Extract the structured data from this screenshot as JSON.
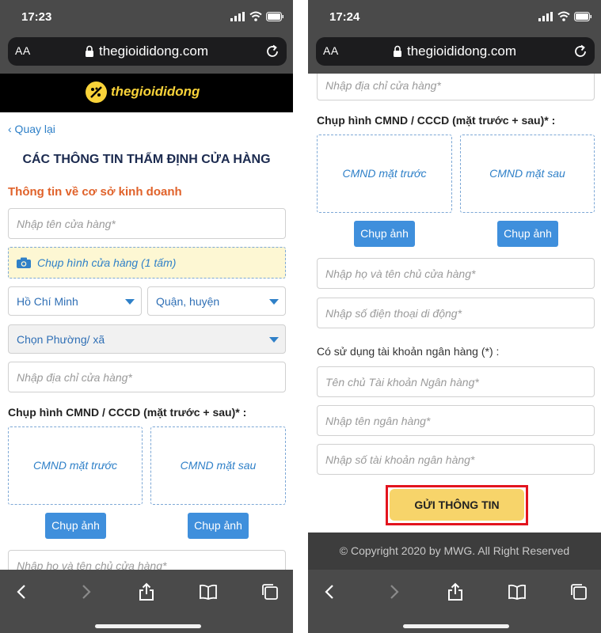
{
  "left": {
    "status": {
      "time": "17:23"
    },
    "url": {
      "aa_label": "AA",
      "host": "thegioididong.com"
    },
    "brand": {
      "name": "thegioididong"
    },
    "back_label": "‹ Quay lại",
    "title": "CÁC THÔNG TIN THẨM ĐỊNH CỬA HÀNG",
    "section_title": "Thông tin về cơ sở kinh doanh",
    "store_name_placeholder": "Nhập tên cửa hàng*",
    "store_photo_label": "Chụp hình cửa hàng (1 tấm)",
    "city_select": "Hồ Chí Minh",
    "district_select": "Quận, huyện",
    "ward_select": "Chọn Phường/ xã",
    "address_placeholder": "Nhập địa chỉ cửa hàng*",
    "id_section_label": "Chụp hình CMND / CCCD (mặt trước + sau)* :",
    "id_front_label": "CMND mặt trước",
    "id_back_label": "CMND mặt sau",
    "capture_label": "Chụp ảnh",
    "owner_name_placeholder": "Nhập họ và tên chủ cửa hàng*"
  },
  "right": {
    "status": {
      "time": "17:24"
    },
    "url": {
      "aa_label": "AA",
      "host": "thegioididong.com"
    },
    "address_placeholder": "Nhập địa chỉ cửa hàng*",
    "id_section_label": "Chụp hình CMND / CCCD (mặt trước + sau)* :",
    "id_front_label": "CMND mặt trước",
    "id_back_label": "CMND mặt sau",
    "capture_label": "Chụp ảnh",
    "owner_name_placeholder": "Nhập họ và tên chủ cửa hàng*",
    "phone_placeholder": "Nhập số điện thoại di động*",
    "bank_question": "Có sử dụng tài khoản ngân hàng (*) :",
    "bank_holder_placeholder": "Tên chủ Tài khoản Ngân hàng*",
    "bank_name_placeholder": "Nhập tên ngân hàng*",
    "bank_account_placeholder": "Nhập số tài khoản ngân hàng*",
    "submit_label": "GỬI THÔNG TIN",
    "footer_text": "© Copyright 2020 by MWG. All Right Reserved"
  },
  "colors": {
    "accent_blue": "#2f80c8",
    "section_orange": "#e0622a",
    "brand_yellow": "#f9d339",
    "submit_yellow": "#f7d46a",
    "highlight_red": "#e3141e"
  },
  "icons": [
    "signal-icon",
    "wifi-icon",
    "battery-icon",
    "lock-icon",
    "reload-icon",
    "camera-icon",
    "back-arrow-icon",
    "forward-arrow-icon",
    "share-icon",
    "bookmarks-icon",
    "tabs-icon"
  ]
}
